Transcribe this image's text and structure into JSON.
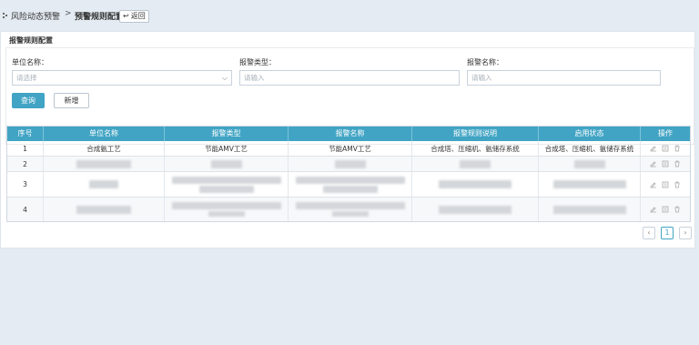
{
  "breadcrumb": {
    "parent": "风险动态预警",
    "separator": ">",
    "current": "预警规则配置",
    "back_label": "返回"
  },
  "panel": {
    "title": "报警规则配置"
  },
  "form": {
    "unit": {
      "label": "单位名称：",
      "placeholder": "请选择"
    },
    "type": {
      "label": "报警类型：",
      "placeholder": "请输入"
    },
    "name": {
      "label": "报警名称：",
      "placeholder": "请输入"
    },
    "query_label": "查询",
    "new_label": "新增"
  },
  "table": {
    "headers": [
      "序号",
      "单位名称",
      "报警类型",
      "报警名称",
      "报警规则说明",
      "启用状态",
      "操作"
    ],
    "rows": [
      {
        "index": "1",
        "unit": "合成氨工艺",
        "type": "节能AMV工艺",
        "name": "节能AMV工艺",
        "desc": "合成塔、压缩机、氨储存系统",
        "status": "合成塔、压缩机、氨储存系统"
      },
      {
        "index": "2"
      },
      {
        "index": "3"
      },
      {
        "index": "4"
      }
    ]
  },
  "pagination": {
    "prev": "‹",
    "current_page": "1",
    "next": "›"
  },
  "colors": {
    "accent": "#41a4c4",
    "background": "#e4ebf2"
  },
  "icons": [
    "edit-icon",
    "view-icon",
    "delete-icon",
    "back-arrow-icon",
    "chevron-down-icon"
  ]
}
